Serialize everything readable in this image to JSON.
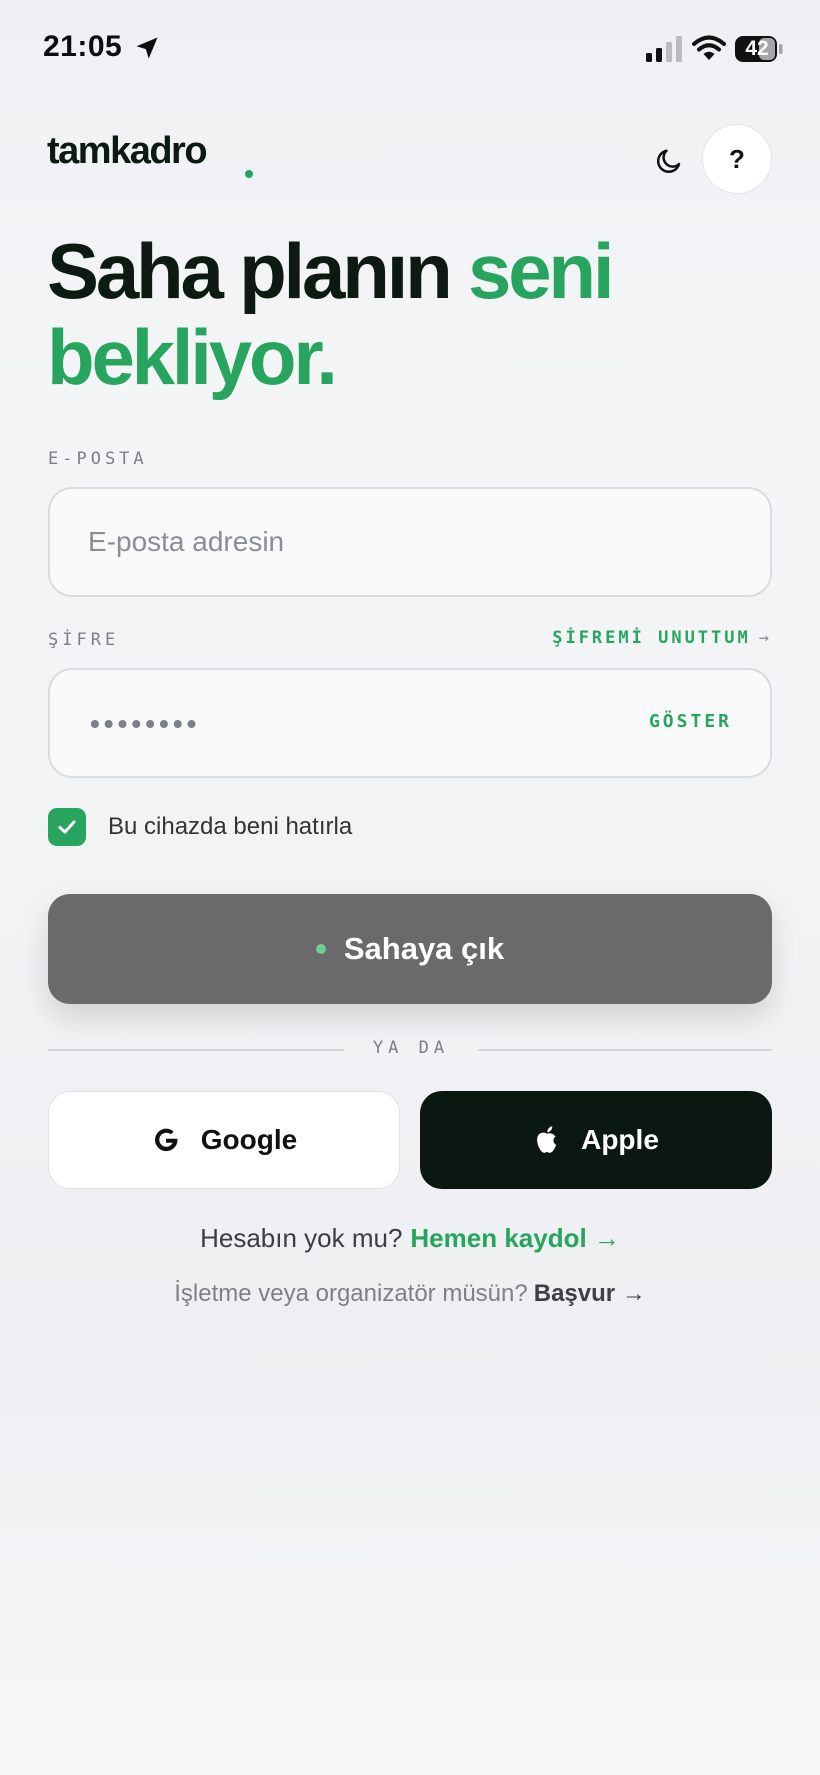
{
  "status_bar": {
    "time": "21:05",
    "battery": "42",
    "icons": [
      "location-arrow-icon",
      "signal-icon",
      "wifi-icon",
      "battery-icon"
    ]
  },
  "header": {
    "logo": "tamkadro",
    "theme_icon": "moon-icon",
    "help_label": "?"
  },
  "hero": {
    "title_part1": "Saha planın",
    "title_accent1": "seni",
    "title_accent2": "bekliyor."
  },
  "form": {
    "email_label": "E-POSTA",
    "email_placeholder": "E-posta adresin",
    "password_label": "ŞİFRE",
    "forgot_label": "ŞİFREMİ UNUTTUM",
    "forgot_arrow": "→",
    "password_value": "••••••••",
    "show_label": "GÖSTER",
    "remember_label": "Bu cihazda beni hatırla",
    "remember_checked": true,
    "submit_label": "Sahaya çık"
  },
  "divider": {
    "label": "YA DA"
  },
  "social": {
    "google_label": "Google",
    "apple_label": "Apple"
  },
  "footer": {
    "signup_prompt": "Hesabın yok mu?",
    "signup_link": "Hemen kaydol →",
    "business_prompt": "İşletme veya organizatör müsün?",
    "business_link": "Başvur →"
  },
  "colors": {
    "accent": "#27a55e",
    "dark": "#0c1a12",
    "submit_bg": "#6a6a6a",
    "apple_bg": "#0b1711"
  }
}
